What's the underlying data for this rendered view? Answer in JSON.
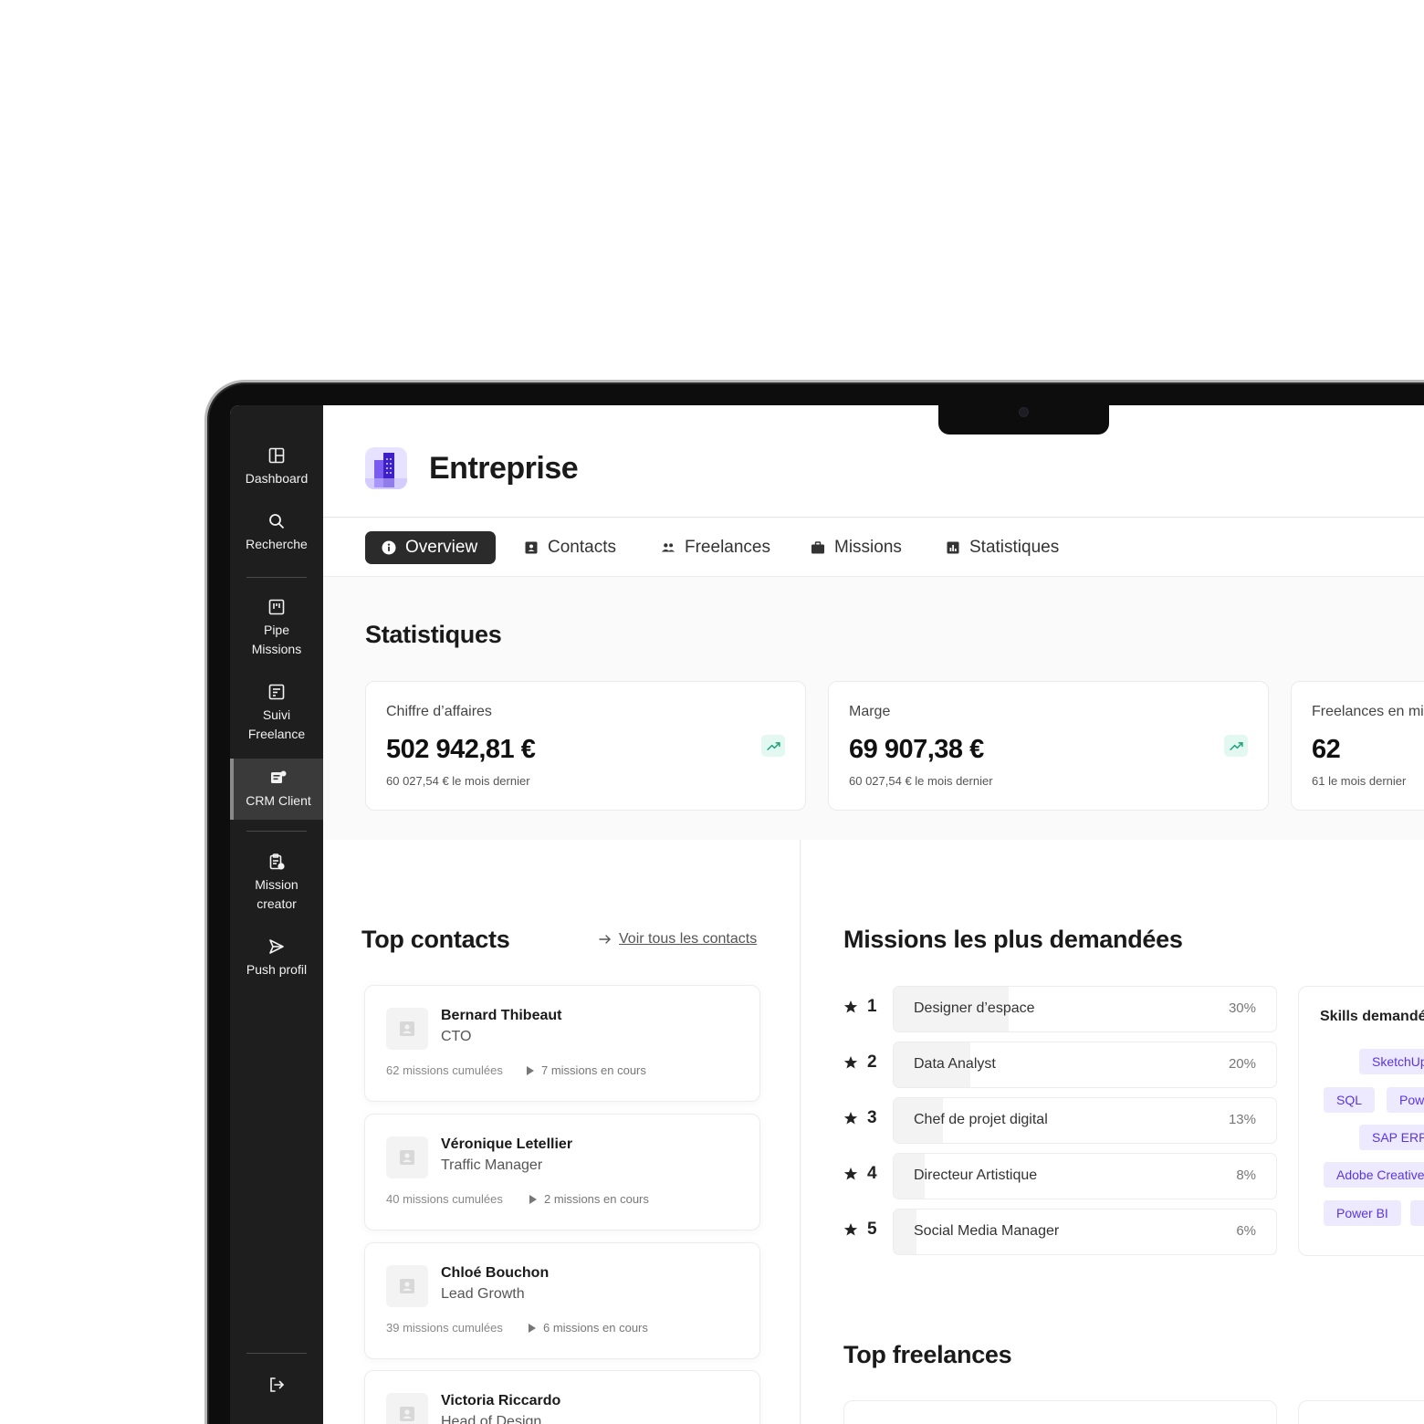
{
  "sidebar": {
    "items": [
      {
        "label": "Dashboard"
      },
      {
        "label": "Recherche"
      },
      {
        "label": "Pipe\nMissions"
      },
      {
        "label": "Suivi\nFreelance"
      },
      {
        "label": "CRM Client"
      },
      {
        "label": "Mission\ncreator"
      },
      {
        "label": "Push profil"
      }
    ]
  },
  "header": {
    "title": "Entreprise"
  },
  "tabs": [
    {
      "label": "Overview"
    },
    {
      "label": "Contacts"
    },
    {
      "label": "Freelances"
    },
    {
      "label": "Missions"
    },
    {
      "label": "Statistiques"
    }
  ],
  "stats": {
    "title": "Statistiques",
    "cards": [
      {
        "label": "Chiffre d’affaires",
        "value": "502 942,81 €",
        "previous": "60 027,54 € le mois dernier"
      },
      {
        "label": "Marge",
        "value": "69 907,38 €",
        "previous": "60 027,54 € le mois dernier"
      },
      {
        "label": "Freelances en mis",
        "value": "62",
        "previous": "61 le mois dernier"
      }
    ]
  },
  "top_contacts": {
    "title": "Top contacts",
    "view_all": "Voir tous les contacts",
    "items": [
      {
        "name": "Bernard Thibeaut",
        "role": "CTO",
        "total": "62 missions cumulées",
        "current": "7 missions en cours"
      },
      {
        "name": "Véronique Letellier",
        "role": "Traffic Manager",
        "total": "40 missions cumulées",
        "current": "2 missions en cours"
      },
      {
        "name": "Chloé Bouchon",
        "role": "Lead Growth",
        "total": "39 missions cumulées",
        "current": "6 missions en cours"
      },
      {
        "name": "Victoria Riccardo",
        "role": "Head of Design",
        "total": "",
        "current": ""
      }
    ]
  },
  "missions": {
    "title": "Missions les plus demandées",
    "items": [
      {
        "rank": "1",
        "label": "Designer d’espace",
        "pct": "30%",
        "share": 0.3
      },
      {
        "rank": "2",
        "label": "Data Analyst",
        "pct": "20%",
        "share": 0.2
      },
      {
        "rank": "3",
        "label": "Chef de projet digital",
        "pct": "13%",
        "share": 0.13
      },
      {
        "rank": "4",
        "label": "Directeur Artistique",
        "pct": "8%",
        "share": 0.08
      },
      {
        "rank": "5",
        "label": "Social Media Manager",
        "pct": "6%",
        "share": 0.06
      }
    ]
  },
  "skills": {
    "title": "Skills demandés",
    "chips": [
      "SketchUp",
      "SQL",
      "Pow",
      "SAP ERP",
      "Adobe Creative",
      "Power BI"
    ]
  },
  "top_freelances": {
    "title": "Top freelances"
  },
  "colors": {
    "sidebar": "#1e1e1e",
    "accent": "#5b35e0",
    "chip_bg": "#ede9ff",
    "trend_bg": "#e3f8f1",
    "trend": "#1aa37a"
  }
}
